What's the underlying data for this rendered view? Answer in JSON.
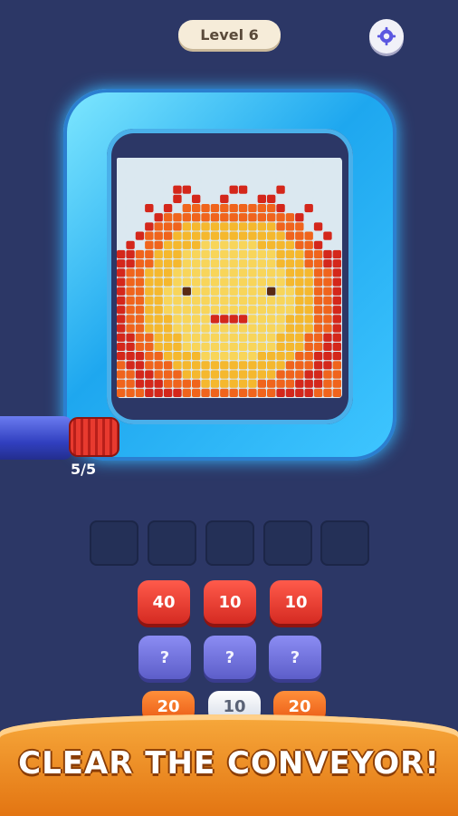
{
  "header": {
    "level_label": "Level 6",
    "settings_icon": "gear-icon"
  },
  "conveyor": {
    "counter": "5/5"
  },
  "slots": [
    "",
    "",
    "",
    "",
    ""
  ],
  "spools": {
    "row1": [
      "40",
      "10",
      "10"
    ],
    "row2": [
      "?",
      "?",
      "?"
    ],
    "row3": [
      "20",
      "10",
      "20"
    ]
  },
  "banner": {
    "text": "CLEAR THE CONVEYOR!"
  },
  "colors": {
    "background": "#2c3766",
    "frame": "#1ea7ef",
    "red_spool": "#e83a2f",
    "purple_spool": "#6d6ee0",
    "banner": "#f39a2c"
  }
}
